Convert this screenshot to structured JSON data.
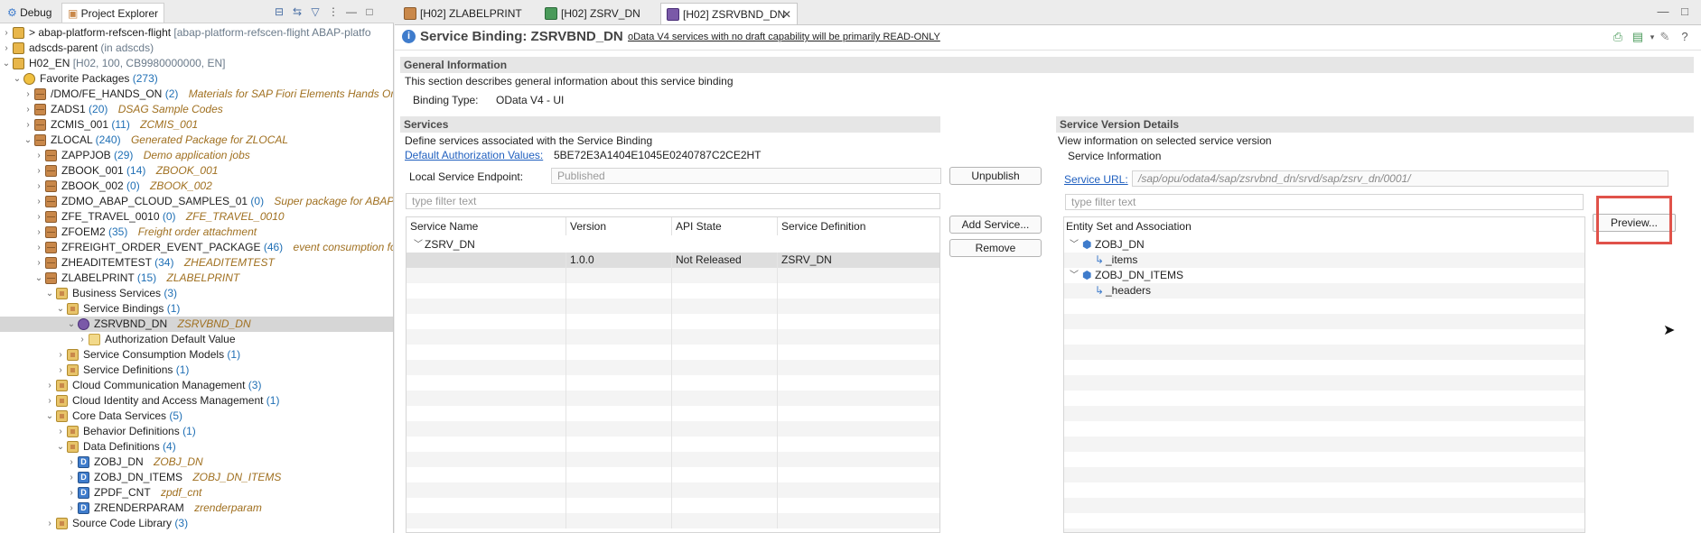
{
  "left_tabs": [
    "Debug",
    "Project Explorer"
  ],
  "tree": [
    {
      "t": "> abap-platform-refscen-flight",
      "c": "",
      "d": "[abap-platform-refscen-flight ABAP-platfo",
      "dc": "gray",
      "lvl": 0,
      "ex": "c",
      "icon": "proj"
    },
    {
      "t": "adscds-parent",
      "c": "",
      "d": "(in adscds)",
      "dc": "gray",
      "lvl": 0,
      "ex": "c",
      "icon": "proj"
    },
    {
      "t": "H02_EN",
      "c": "",
      "d": "[H02, 100, CB9980000000, EN]",
      "dc": "gray",
      "lvl": 0,
      "ex": "o",
      "icon": "proj"
    },
    {
      "t": "Favorite Packages",
      "c": "(273)",
      "d": "",
      "dc": "",
      "lvl": 1,
      "ex": "o",
      "icon": "star"
    },
    {
      "t": "/DMO/FE_HANDS_ON",
      "c": "(2)",
      "d": "Materials for SAP Fiori Elements Hands On",
      "dc": "desc",
      "lvl": 2,
      "ex": "c",
      "icon": "pkg"
    },
    {
      "t": "ZADS1",
      "c": "(20)",
      "d": "DSAG Sample Codes",
      "dc": "desc",
      "lvl": 2,
      "ex": "c",
      "icon": "pkg"
    },
    {
      "t": "ZCMIS_001",
      "c": "(11)",
      "d": "ZCMIS_001",
      "dc": "desc",
      "lvl": 2,
      "ex": "c",
      "icon": "pkg"
    },
    {
      "t": "ZLOCAL",
      "c": "(240)",
      "d": "Generated Package for ZLOCAL",
      "dc": "desc",
      "lvl": 2,
      "ex": "o",
      "icon": "pkg"
    },
    {
      "t": "ZAPPJOB",
      "c": "(29)",
      "d": "Demo application jobs",
      "dc": "desc",
      "lvl": 3,
      "ex": "c",
      "icon": "pkg"
    },
    {
      "t": "ZBOOK_001",
      "c": "(14)",
      "d": "ZBOOK_001",
      "dc": "desc",
      "lvl": 3,
      "ex": "c",
      "icon": "pkg"
    },
    {
      "t": "ZBOOK_002",
      "c": "(0)",
      "d": "ZBOOK_002",
      "dc": "desc",
      "lvl": 3,
      "ex": "c",
      "icon": "pkg"
    },
    {
      "t": "ZDMO_ABAP_CLOUD_SAMPLES_01",
      "c": "(0)",
      "d": "Super package for ABAP C",
      "dc": "desc",
      "lvl": 3,
      "ex": "c",
      "icon": "pkg"
    },
    {
      "t": "ZFE_TRAVEL_0010",
      "c": "(0)",
      "d": "ZFE_TRAVEL_0010",
      "dc": "desc",
      "lvl": 3,
      "ex": "c",
      "icon": "pkg"
    },
    {
      "t": "ZFOEM2",
      "c": "(35)",
      "d": "Freight order attachment",
      "dc": "desc",
      "lvl": 3,
      "ex": "c",
      "icon": "pkg"
    },
    {
      "t": "ZFREIGHT_ORDER_EVENT_PACKAGE",
      "c": "(46)",
      "d": "event consumption for",
      "dc": "desc",
      "lvl": 3,
      "ex": "c",
      "icon": "pkg"
    },
    {
      "t": "ZHEADITEMTEST",
      "c": "(34)",
      "d": "ZHEADITEMTEST",
      "dc": "desc",
      "lvl": 3,
      "ex": "c",
      "icon": "pkg"
    },
    {
      "t": "ZLABELPRINT",
      "c": "(15)",
      "d": "ZLABELPRINT",
      "dc": "desc",
      "lvl": 3,
      "ex": "o",
      "icon": "pkg"
    },
    {
      "t": "Business Services",
      "c": "(3)",
      "d": "",
      "dc": "",
      "lvl": 4,
      "ex": "o",
      "icon": "fold"
    },
    {
      "t": "Service Bindings",
      "c": "(1)",
      "d": "",
      "dc": "",
      "lvl": 5,
      "ex": "o",
      "icon": "fold"
    },
    {
      "t": "ZSRVBND_DN",
      "c": "",
      "d": "ZSRVBND_DN",
      "dc": "desc",
      "lvl": 6,
      "ex": "o",
      "icon": "sb",
      "sel": true
    },
    {
      "t": "Authorization Default Value",
      "c": "",
      "d": "",
      "dc": "",
      "lvl": 7,
      "ex": "c",
      "icon": "fopen"
    },
    {
      "t": "Service Consumption Models",
      "c": "(1)",
      "d": "",
      "dc": "",
      "lvl": 5,
      "ex": "c",
      "icon": "fold"
    },
    {
      "t": "Service Definitions",
      "c": "(1)",
      "d": "",
      "dc": "",
      "lvl": 5,
      "ex": "c",
      "icon": "fold"
    },
    {
      "t": "Cloud Communication Management",
      "c": "(3)",
      "d": "",
      "dc": "",
      "lvl": 4,
      "ex": "c",
      "icon": "fold"
    },
    {
      "t": "Cloud Identity and Access Management",
      "c": "(1)",
      "d": "",
      "dc": "",
      "lvl": 4,
      "ex": "c",
      "icon": "fold"
    },
    {
      "t": "Core Data Services",
      "c": "(5)",
      "d": "",
      "dc": "",
      "lvl": 4,
      "ex": "o",
      "icon": "fold"
    },
    {
      "t": "Behavior Definitions",
      "c": "(1)",
      "d": "",
      "dc": "",
      "lvl": 5,
      "ex": "c",
      "icon": "fold"
    },
    {
      "t": "Data Definitions",
      "c": "(4)",
      "d": "",
      "dc": "",
      "lvl": 5,
      "ex": "o",
      "icon": "fold"
    },
    {
      "t": "ZOBJ_DN",
      "c": "",
      "d": "ZOBJ_DN",
      "dc": "desc",
      "lvl": 6,
      "ex": "c",
      "icon": "dd"
    },
    {
      "t": "ZOBJ_DN_ITEMS",
      "c": "",
      "d": "ZOBJ_DN_ITEMS",
      "dc": "desc",
      "lvl": 6,
      "ex": "c",
      "icon": "dd"
    },
    {
      "t": "ZPDF_CNT",
      "c": "",
      "d": "zpdf_cnt",
      "dc": "desc",
      "lvl": 6,
      "ex": "c",
      "icon": "dd"
    },
    {
      "t": "ZRENDERPARAM",
      "c": "",
      "d": "zrenderparam",
      "dc": "desc",
      "lvl": 6,
      "ex": "c",
      "icon": "dd"
    },
    {
      "t": "Source Code Library",
      "c": "(3)",
      "d": "",
      "dc": "",
      "lvl": 4,
      "ex": "c",
      "icon": "fold"
    }
  ],
  "editor_tabs": [
    {
      "label": "[H02] ZLABELPRINT",
      "icon": "pkg"
    },
    {
      "label": "[H02] ZSRV_DN",
      "icon": "srv"
    },
    {
      "label": "[H02] ZSRVBND_DN",
      "icon": "sb",
      "close": "✕"
    }
  ],
  "header": {
    "title": "Service Binding: ZSRVBND_DN",
    "info": "oData V4 services with no draft capability will be primarily READ-ONLY"
  },
  "general": {
    "title": "General Information",
    "desc": "This section describes general information about this service binding",
    "binding_type_label": "Binding Type:",
    "binding_type_value": "OData V4 - UI"
  },
  "services": {
    "title": "Services",
    "desc": "Define services associated with the Service Binding",
    "auth_label": "Default Authorization Values:",
    "auth_value": "5BE72E3A1404E1045E0240787C2CE2HT",
    "endpoint_label": "Local Service Endpoint:",
    "endpoint_value": "Published",
    "unpublish": "Unpublish",
    "filter_placeholder": "type filter text",
    "cols": [
      "Service Name",
      "Version",
      "API State",
      "Service Definition"
    ],
    "group": "ZSRV_DN",
    "row": [
      "",
      "1.0.0",
      "Not Released",
      "ZSRV_DN"
    ],
    "add": "Add Service...",
    "remove": "Remove"
  },
  "svd": {
    "title": "Service Version Details",
    "desc": "View information on selected service version",
    "subtitle": "Service Information",
    "url_label": "Service URL:",
    "url_value": "/sap/opu/odata4/sap/zsrvbnd_dn/srvd/sap/zsrv_dn/0001/",
    "filter_placeholder": "type filter text",
    "entity_header": "Entity Set and Association",
    "entities": [
      {
        "name": "ZOBJ_DN",
        "child": "_items"
      },
      {
        "name": "ZOBJ_DN_ITEMS",
        "child": "_headers"
      }
    ],
    "preview": "Preview..."
  },
  "colors": {
    "highlight_box": "#e0524a"
  }
}
